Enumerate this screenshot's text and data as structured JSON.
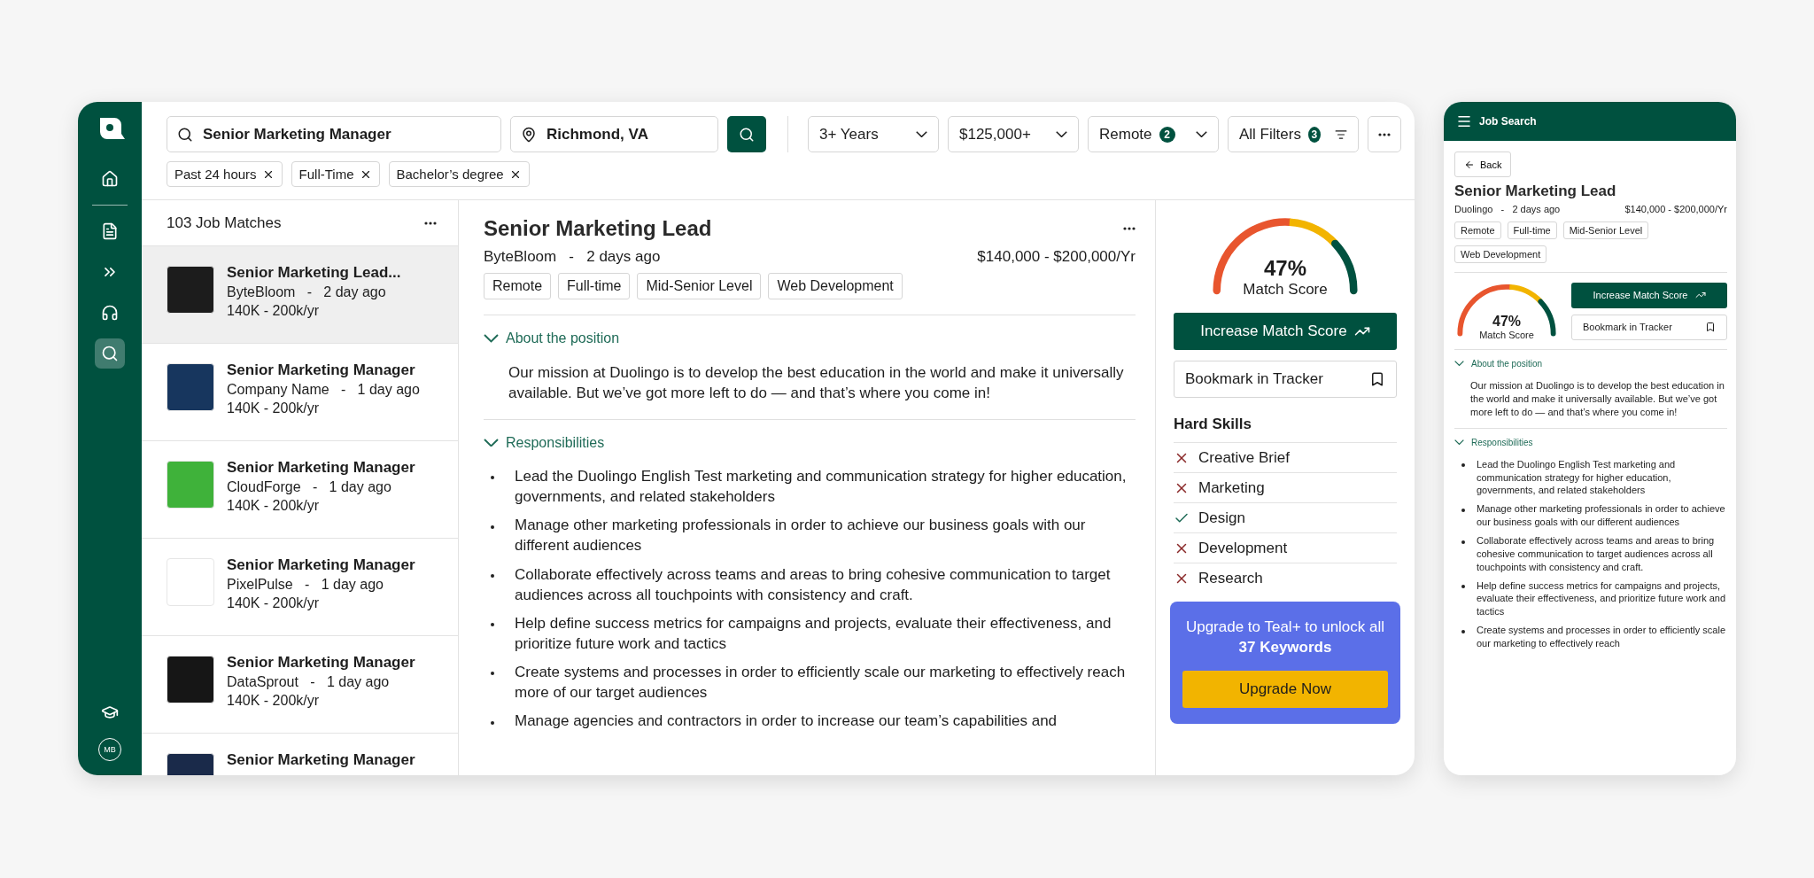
{
  "sidebar": {
    "nav": [
      {
        "kind": "home",
        "selected": false
      },
      {
        "kind": "document",
        "selected": false
      },
      {
        "kind": "chevrons",
        "selected": false
      },
      {
        "kind": "headset",
        "selected": false
      },
      {
        "kind": "search",
        "selected": true
      }
    ],
    "bottom": [
      {
        "kind": "academy",
        "selected": false
      }
    ],
    "avatar": "MB"
  },
  "search": {
    "query": "Senior Marketing Manager",
    "location": "Richmond, VA"
  },
  "filters": [
    {
      "label": "3+ Years",
      "kind": "dropdown"
    },
    {
      "label": "$125,000+",
      "kind": "dropdown"
    },
    {
      "label": "Remote",
      "badge": "2",
      "kind": "dropdown"
    },
    {
      "label": "All Filters",
      "badge": "3",
      "kind": "filters"
    }
  ],
  "chips": [
    "Past 24 hours",
    "Full-Time",
    "Bachelor’s degree"
  ],
  "job_list": {
    "count_label": "103 Job Matches",
    "jobs": [
      {
        "title": "Senior Marketing Lead...",
        "byline": "ByteBloom   -   2 day ago",
        "salary": "140K - 200k/yr",
        "selected": true,
        "color": "#1c1c1c"
      },
      {
        "title": "Senior Marketing Manager",
        "byline": "Company Name   -   1 day ago",
        "salary": "140K - 200k/yr",
        "selected": false,
        "color": "#17365e"
      },
      {
        "title": "Senior Marketing Manager",
        "byline": "CloudForge   -   1 day ago",
        "salary": "140K - 200k/yr",
        "selected": false,
        "color": "#3fb23a"
      },
      {
        "title": "Senior Marketing Manager",
        "byline": "PixelPulse   -   1 day ago",
        "salary": "140K - 200k/yr",
        "selected": false,
        "color": "#ffffff"
      },
      {
        "title": "Senior Marketing Manager",
        "byline": "DataSprout   -   1 day ago",
        "salary": "140K - 200k/yr",
        "selected": false,
        "color": "#161616"
      },
      {
        "title": "Senior Marketing Manager",
        "selected": false,
        "color": "#1a2a4a"
      }
    ]
  },
  "detail": {
    "title": "Senior Marketing Lead",
    "byline": "ByteBloom   -   2 days ago",
    "salary": "$140,000 - $200,000/Yr",
    "tags": [
      "Remote",
      "Full-time",
      "Mid-Senior Level",
      "Web Development"
    ],
    "sections": [
      {
        "heading": "About the position",
        "expanded": true,
        "kind": "paragraph",
        "text": "Our mission at Duolingo is to develop the best education in the world and make it universally available. But we’ve got more left to do — and that’s where you come in!"
      },
      {
        "heading": "Responsibilities",
        "expanded": true,
        "kind": "bullets",
        "items": [
          "Lead the Duolingo English Test marketing and communication strategy for higher education, governments, and related stakeholders",
          "Manage other marketing professionals in order to achieve our business goals with our different audiences",
          "Collaborate effectively across teams and areas to bring cohesive communication to target audiences across all touchpoints with consistency and craft.",
          "Help define success metrics for campaigns and projects, evaluate their effectiveness, and prioritize future work and tactics",
          "Create systems and processes in order to efficiently scale our marketing to effectively reach more of our target audiences",
          "Manage agencies and contractors in order to increase our team’s capabilities and"
        ]
      }
    ]
  },
  "match": {
    "score": "47%",
    "label": "Match Score",
    "increase_button": "Increase Match Score",
    "bookmark_button": "Bookmark in Tracker"
  },
  "hard_skills": {
    "heading": "Hard Skills",
    "skills": [
      {
        "name": "Creative Brief",
        "matched": false
      },
      {
        "name": "Marketing",
        "matched": false
      },
      {
        "name": "Design",
        "matched": true
      },
      {
        "name": "Development",
        "matched": false
      },
      {
        "name": "Research",
        "matched": false
      }
    ]
  },
  "upgrade": {
    "text": "Upgrade to Teal+ to unlock all **37 Keywords**",
    "button": "Upgrade Now"
  },
  "mobile": {
    "header": "Job Search",
    "back": "Back",
    "title": "Senior Marketing Lead",
    "byline": "Duolingo   -   2 days ago",
    "salary": "$140,000 - $200,000/Yr",
    "tags": [
      "Remote",
      "Full-time",
      "Mid-Senior Level",
      "Web Development"
    ],
    "score": "47%",
    "score_label": "Match Score",
    "increase_button": "Increase Match Score",
    "bookmark_button": "Bookmark in Tracker",
    "sections": [
      {
        "heading": "About the position",
        "expanded": true,
        "kind": "paragraph",
        "text": "Our mission at Duolingo is to develop the best education in the world and make it universally available. But we’ve got more left to do — and that’s where you come in!"
      },
      {
        "heading": "Responsibilities",
        "expanded": true,
        "kind": "bullets",
        "items": [
          "Lead the Duolingo English Test marketing and communication strategy for higher education, governments, and related stakeholders",
          "Manage other marketing professionals in order to achieve our business goals with our different audiences",
          "Collaborate effectively across teams and areas to bring cohesive communication to target audiences across all touchpoints with consistency and craft.",
          "Help define success metrics for campaigns and projects, evaluate their effectiveness, and prioritize future work and tactics",
          "Create systems and processes in order to efficiently scale our marketing to effectively reach"
        ]
      }
    ]
  }
}
